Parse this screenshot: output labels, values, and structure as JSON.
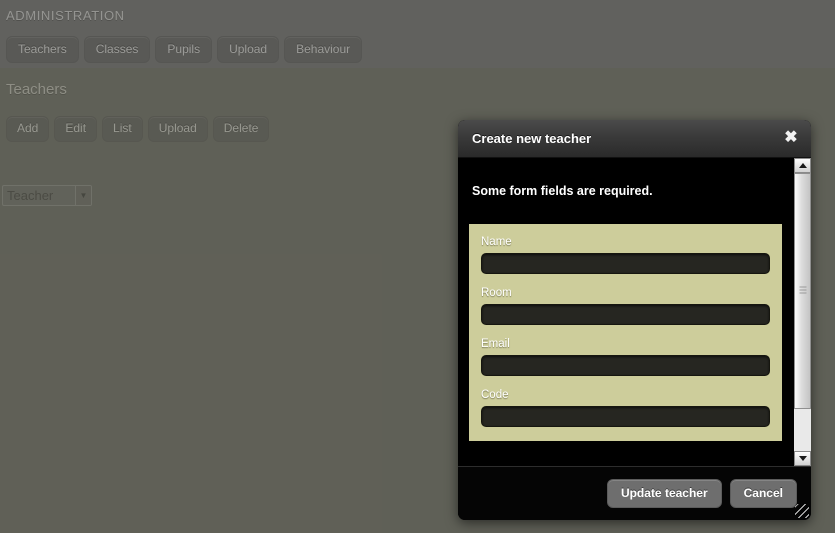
{
  "page": {
    "header_title": "ADMINISTRATION",
    "section_title": "Teachers",
    "nav_tabs": [
      {
        "label": "Teachers"
      },
      {
        "label": "Classes"
      },
      {
        "label": "Pupils"
      },
      {
        "label": "Upload"
      },
      {
        "label": "Behaviour"
      }
    ],
    "action_buttons": [
      {
        "label": "Add"
      },
      {
        "label": "Edit"
      },
      {
        "label": "List"
      },
      {
        "label": "Upload"
      },
      {
        "label": "Delete"
      }
    ],
    "entity_select": {
      "selected": "Teacher",
      "arrow_glyph": "▼",
      "options": [
        "Teacher"
      ]
    }
  },
  "modal": {
    "title": "Create new teacher",
    "close_glyph": "✖",
    "message": "Some form fields are required.",
    "fields": [
      {
        "label": "Name",
        "value": "",
        "placeholder": ""
      },
      {
        "label": "Room",
        "value": "",
        "placeholder": ""
      },
      {
        "label": "Email",
        "value": "",
        "placeholder": ""
      },
      {
        "label": "Code",
        "value": "",
        "placeholder": ""
      }
    ],
    "footer": {
      "submit_label": "Update teacher",
      "cancel_label": "Cancel"
    },
    "scrollbar": {
      "up_arrow": "up-arrow",
      "down_arrow": "down-arrow"
    }
  },
  "colors": {
    "page_background": "#7b7c71",
    "page_header_band": "#7f7f7f",
    "modal_background": "#000000",
    "form_panel": "#cdcd9b",
    "input_background": "#262621",
    "button_gray": "#6e6e6e"
  }
}
